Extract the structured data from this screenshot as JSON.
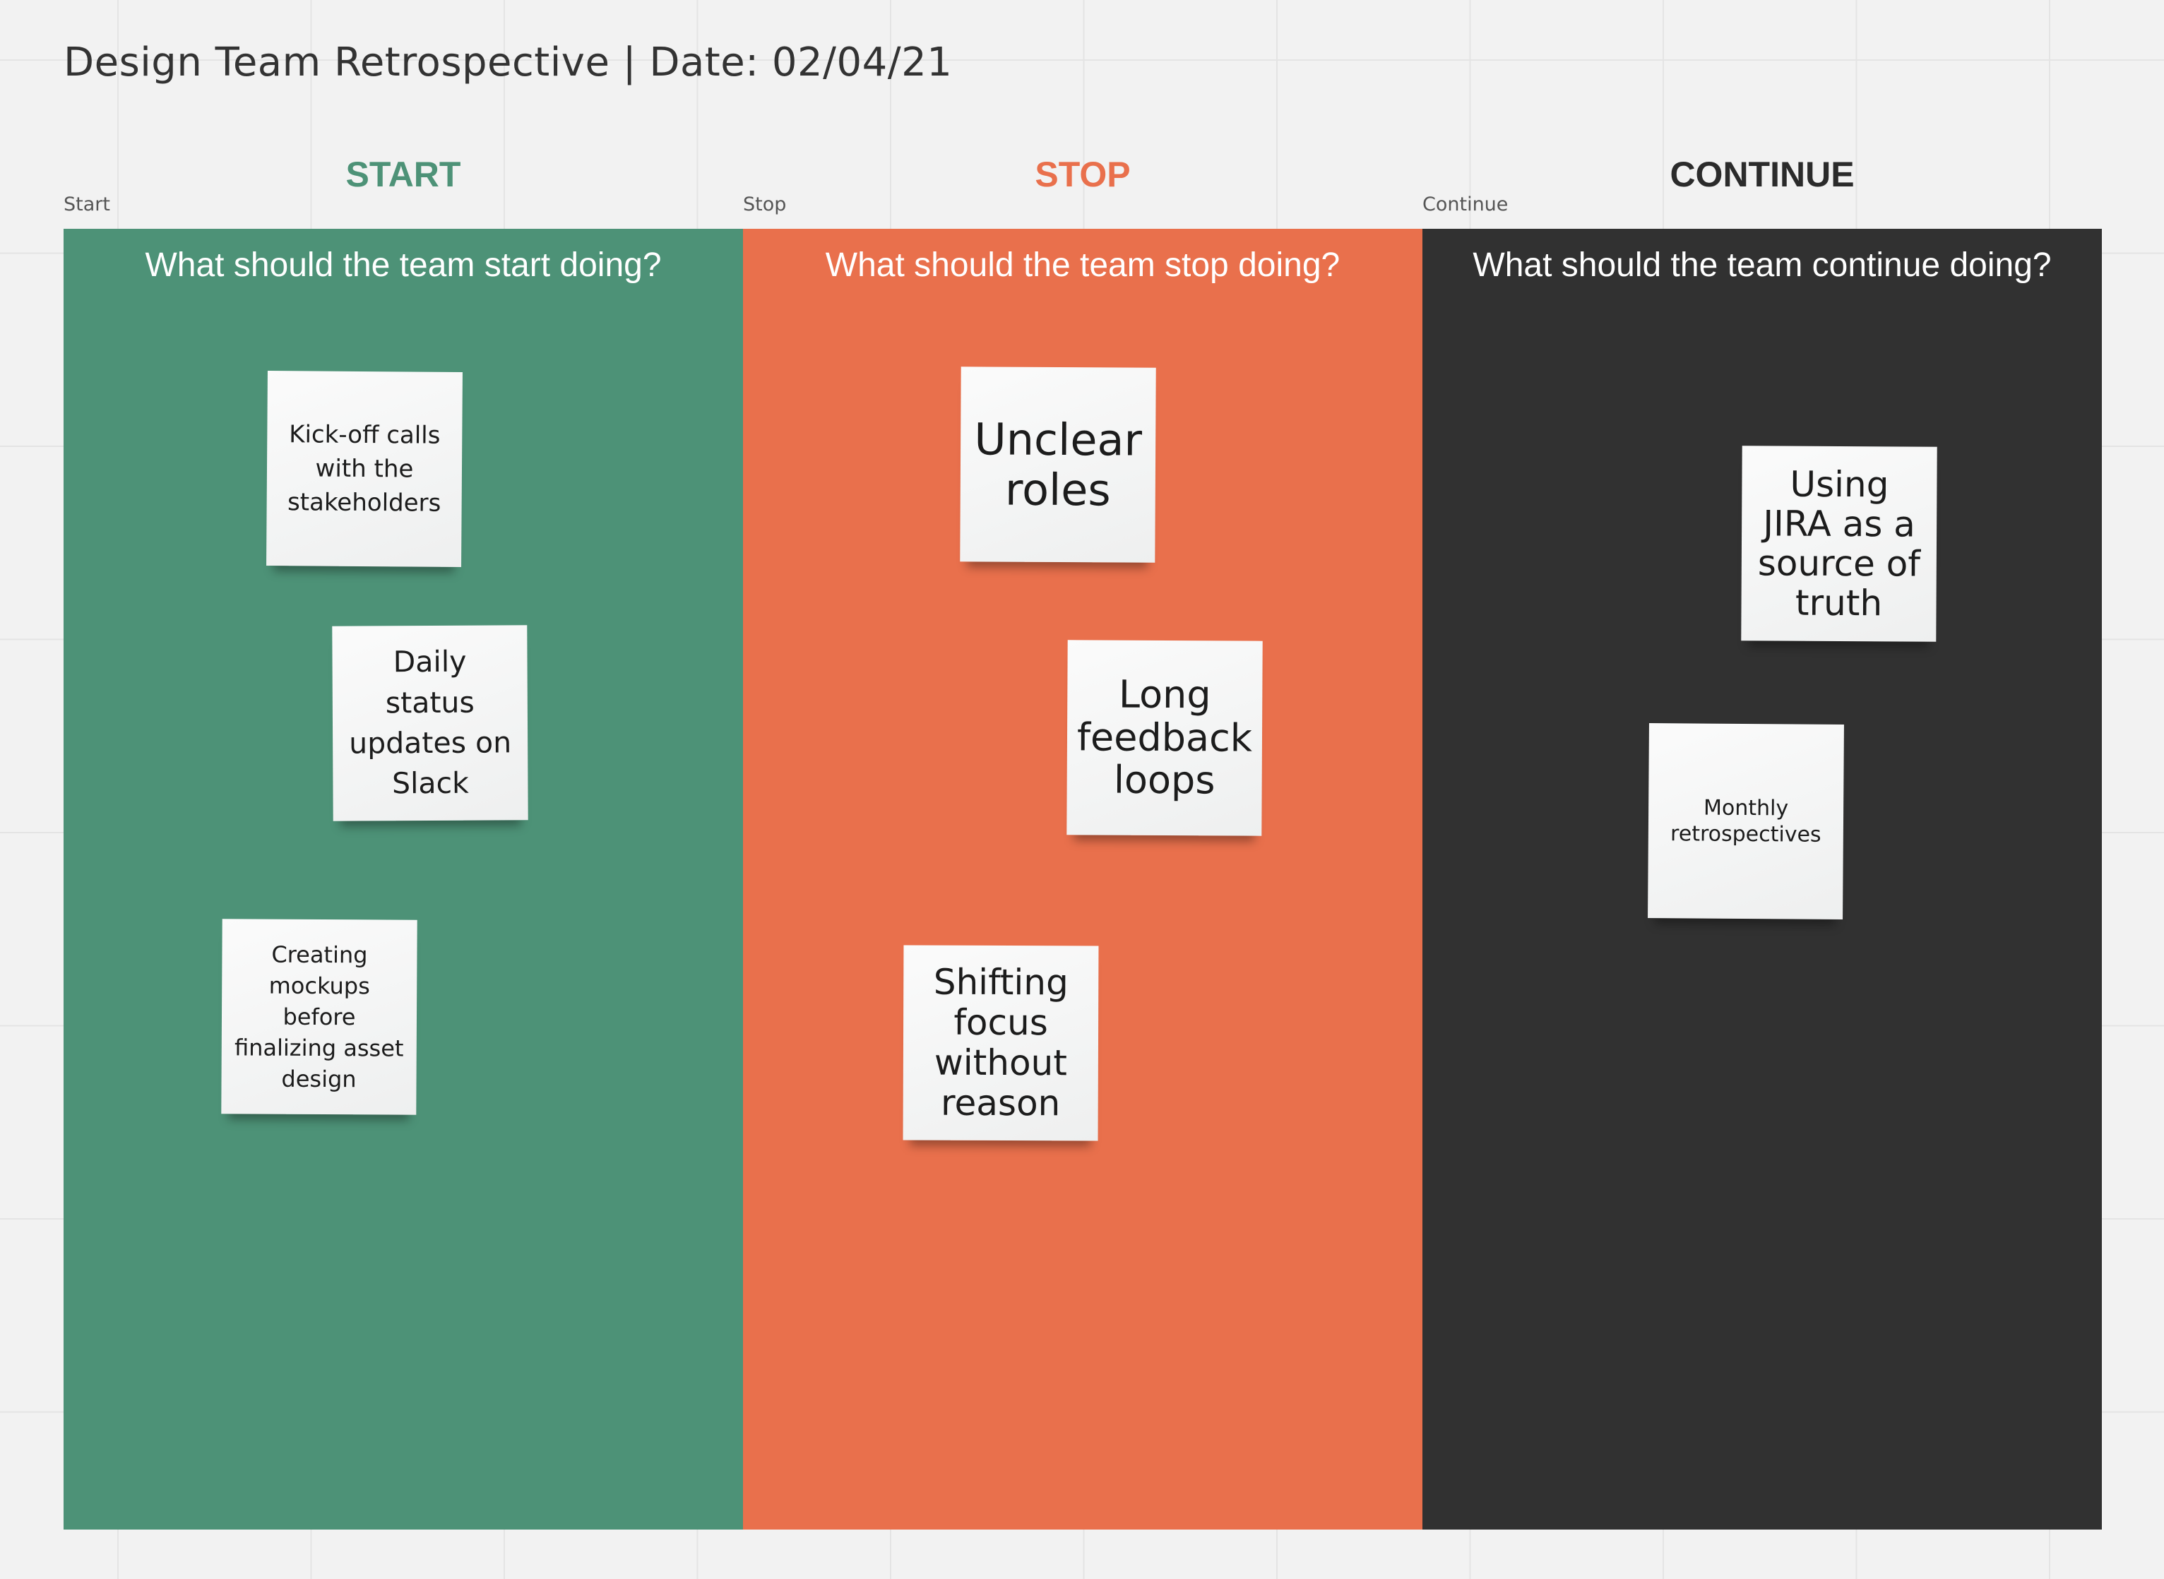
{
  "board": {
    "title": "Design Team Retrospective | Date: 02/04/21"
  },
  "colors": {
    "start": "#4d9277",
    "stop": "#e9704c",
    "continue": "#313131",
    "continue_header": "#2b2b2b",
    "background": "#f2f2f2",
    "sticky": "#f5f6f6"
  },
  "columns": {
    "start": {
      "frame_label": "Start",
      "header": "START",
      "question": "What should the team start doing?",
      "notes": [
        "Kick-off calls with the stakeholders",
        "Daily status updates on Slack",
        "Creating mockups before finalizing asset design"
      ]
    },
    "stop": {
      "frame_label": "Stop",
      "header": "STOP",
      "question": "What should the team stop doing?",
      "notes": [
        "Unclear roles",
        "Long feedback loops",
        "Shifting focus without reason"
      ]
    },
    "continue": {
      "frame_label": "Continue",
      "header": "CONTINUE",
      "question": "What should the team continue doing?",
      "notes": [
        "Using JIRA as a source of truth",
        "Monthly retrospectives"
      ]
    }
  }
}
